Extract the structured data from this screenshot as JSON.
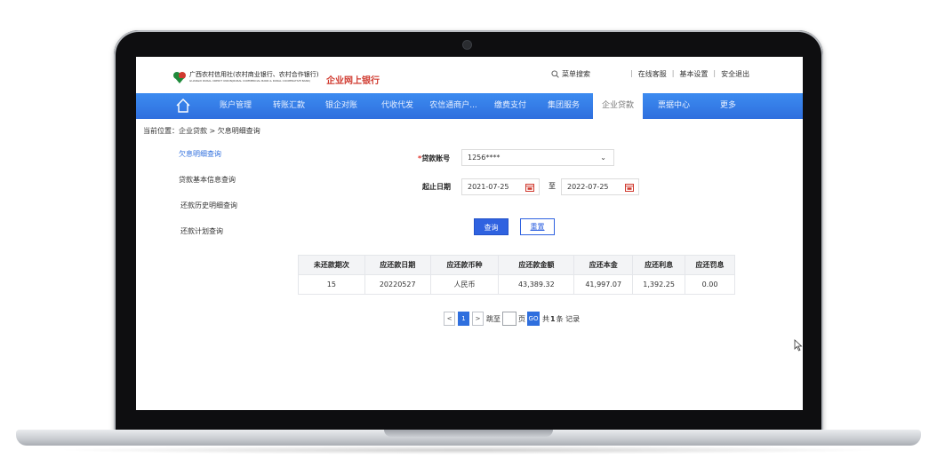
{
  "header": {
    "logo_line1": "广西农村信用社(农村商业银行、农村合作银行)",
    "logo_line2": "GUANGXI RURAL CREDIT UNION(RURAL COMMERCIAL BANK & RURAL COOPERATIVE BANK)",
    "brand": "企业网上银行",
    "search_label": "菜单搜索",
    "links": [
      "在线客服",
      "基本设置",
      "安全退出"
    ]
  },
  "nav": {
    "items": [
      "账户管理",
      "转账汇款",
      "银企对账",
      "代收代发",
      "农信通商户...",
      "缴费支付",
      "集团服务",
      "企业贷款",
      "票据中心",
      "更多"
    ],
    "active_index": 7
  },
  "breadcrumb": "当前位置：企业贷款 > 欠息明细查询",
  "sidebar": {
    "items": [
      "欠息明细查询",
      "贷款基本信息查询",
      "还款历史明细查询",
      "还款计划查询"
    ]
  },
  "form": {
    "loan_account_required": "*",
    "loan_account_label": "贷款账号",
    "loan_account_value": "1256****",
    "date_label": "起止日期",
    "start_date": "2021-07-25",
    "to_label": "至",
    "end_date": "2022-07-25",
    "query_button": "查询",
    "reset_button": "重置"
  },
  "table": {
    "headers": [
      "未还款期次",
      "应还款日期",
      "应还款币种",
      "应还款金额",
      "应还本金",
      "应还利息",
      "应还罚息"
    ],
    "rows": [
      [
        "15",
        "20220527",
        "人民币",
        "43,389.32",
        "41,997.07",
        "1,392.25",
        "0.00"
      ]
    ]
  },
  "pager": {
    "prev": "<",
    "current": "1",
    "next": ">",
    "jump_label": "跳至",
    "page_label": "页",
    "go": "GO",
    "total_prefix": "共",
    "total_count": "1",
    "total_suffix": "条 记录"
  },
  "colors": {
    "nav_blue": "#2f6fde",
    "brand_red": "#d03a2f",
    "button_blue": "#2f62e0"
  }
}
